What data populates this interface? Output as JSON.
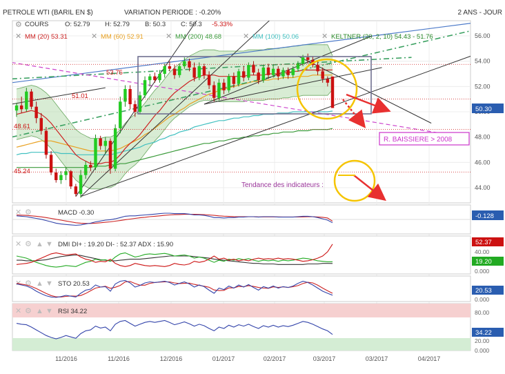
{
  "header": {
    "title": "PETROLE WTI (BARIL EN $)",
    "variation": "VARIATION PERIODE : -0.20%",
    "period": "2 ANS - JOUR"
  },
  "legend": {
    "cours_label": "COURS",
    "open": "O: 52.79",
    "high": "H: 52.79",
    "low": "B: 50.3",
    "close": "C: 50.3",
    "change": "-5.33%",
    "mm20": "MM (20) 53.31",
    "mm60": "MM (60) 52.91",
    "mm200": "MM (200) 48.68",
    "mm100": "MM (100) 50.06",
    "keltner": "KELTNER (20, 2, 10) 54.43 - 51.76"
  },
  "annotations": {
    "levels": [
      "53.75",
      "51.01",
      "48.61",
      "45.24"
    ],
    "resistance_box": "R. BAISSIERE > 2008",
    "tendance": "Tendance des indicateurs :"
  },
  "indicators": {
    "macd": {
      "label": "MACD -0.30",
      "badge": "-0.128"
    },
    "dmi": {
      "label": "DMI DI+ : 19.20 DI- : 52.37 ADX : 15.90",
      "badges": [
        "52.37",
        "19.20"
      ],
      "ticks": [
        "40.00",
        "20.00",
        "0.000"
      ]
    },
    "sto": {
      "label": "STO 20.53",
      "badge": "20.53",
      "ticks": [
        "20.00",
        "0.000"
      ]
    },
    "rsi": {
      "label": "RSI 34.22",
      "badge": "34.22",
      "ticks": [
        "80.00",
        "20.00",
        "0.000"
      ]
    }
  },
  "price_badge": "50.30",
  "colors": {
    "bull": "#22cc22",
    "bear": "#cc1111",
    "mm20": "#cc2222",
    "mm60": "#e8a020",
    "mm200": "#3a9a3a",
    "mm100": "#40c0c0",
    "keltner": "#2a8a2a",
    "annotation_magenta": "#cc33cc",
    "circle": "#f5c400"
  },
  "chart_data": {
    "type": "candlestick",
    "y_ticks": [
      44,
      46,
      48,
      50,
      52,
      54,
      56
    ],
    "y_tick_labels": [
      "44.00",
      "46.00",
      "48.00",
      "50.00",
      "52.00",
      "54.00",
      "56.00"
    ],
    "ylim": [
      42.8,
      57.2
    ],
    "x_tick_labels": [
      "11/2016",
      "11/2016",
      "12/2016",
      "01/2017",
      "02/2017",
      "03/2017",
      "03/2017",
      "04/2017"
    ],
    "candles": [
      {
        "o": 50.1,
        "h": 50.7,
        "l": 49.6,
        "c": 50.5
      },
      {
        "o": 50.5,
        "h": 51.2,
        "l": 49.9,
        "c": 50.2
      },
      {
        "o": 50.2,
        "h": 51.9,
        "l": 50.0,
        "c": 51.6
      },
      {
        "o": 51.6,
        "h": 51.8,
        "l": 50.2,
        "c": 50.4
      },
      {
        "o": 50.4,
        "h": 50.8,
        "l": 49.1,
        "c": 49.5
      },
      {
        "o": 49.5,
        "h": 49.9,
        "l": 48.2,
        "c": 48.5
      },
      {
        "o": 48.5,
        "h": 48.8,
        "l": 46.3,
        "c": 46.6
      },
      {
        "o": 46.6,
        "h": 46.9,
        "l": 45.0,
        "c": 45.2
      },
      {
        "o": 45.2,
        "h": 45.5,
        "l": 44.4,
        "c": 44.6
      },
      {
        "o": 44.6,
        "h": 45.3,
        "l": 44.3,
        "c": 45.0
      },
      {
        "o": 45.0,
        "h": 45.6,
        "l": 44.6,
        "c": 45.3
      },
      {
        "o": 45.3,
        "h": 45.4,
        "l": 43.9,
        "c": 44.1
      },
      {
        "o": 44.1,
        "h": 44.3,
        "l": 43.3,
        "c": 43.5
      },
      {
        "o": 43.5,
        "h": 45.4,
        "l": 43.2,
        "c": 45.0
      },
      {
        "o": 45.0,
        "h": 46.1,
        "l": 44.7,
        "c": 45.8
      },
      {
        "o": 45.8,
        "h": 46.1,
        "l": 45.3,
        "c": 45.6
      },
      {
        "o": 45.6,
        "h": 48.2,
        "l": 45.4,
        "c": 47.9
      },
      {
        "o": 47.9,
        "h": 48.1,
        "l": 47.0,
        "c": 47.3
      },
      {
        "o": 47.3,
        "h": 48.0,
        "l": 46.7,
        "c": 47.7
      },
      {
        "o": 47.7,
        "h": 47.9,
        "l": 45.1,
        "c": 45.5
      },
      {
        "o": 45.5,
        "h": 49.0,
        "l": 45.3,
        "c": 48.7
      },
      {
        "o": 48.7,
        "h": 51.2,
        "l": 48.3,
        "c": 50.8
      },
      {
        "o": 50.8,
        "h": 52.1,
        "l": 50.4,
        "c": 51.8
      },
      {
        "o": 51.8,
        "h": 52.1,
        "l": 50.2,
        "c": 50.6
      },
      {
        "o": 50.6,
        "h": 50.9,
        "l": 49.6,
        "c": 50.0
      },
      {
        "o": 50.0,
        "h": 51.6,
        "l": 49.8,
        "c": 51.3
      },
      {
        "o": 51.3,
        "h": 52.8,
        "l": 51.1,
        "c": 52.5
      },
      {
        "o": 52.5,
        "h": 53.0,
        "l": 52.0,
        "c": 52.8
      },
      {
        "o": 52.8,
        "h": 53.1,
        "l": 52.3,
        "c": 52.5
      },
      {
        "o": 52.5,
        "h": 53.3,
        "l": 52.3,
        "c": 53.0
      },
      {
        "o": 53.0,
        "h": 53.8,
        "l": 52.7,
        "c": 53.6
      },
      {
        "o": 53.6,
        "h": 54.0,
        "l": 53.2,
        "c": 53.4
      },
      {
        "o": 53.4,
        "h": 53.7,
        "l": 52.6,
        "c": 52.9
      },
      {
        "o": 52.9,
        "h": 53.8,
        "l": 52.7,
        "c": 53.6
      },
      {
        "o": 53.6,
        "h": 54.3,
        "l": 53.4,
        "c": 54.0
      },
      {
        "o": 54.0,
        "h": 54.2,
        "l": 53.2,
        "c": 53.5
      },
      {
        "o": 53.5,
        "h": 53.9,
        "l": 52.4,
        "c": 52.7
      },
      {
        "o": 52.7,
        "h": 53.9,
        "l": 52.5,
        "c": 53.6
      },
      {
        "o": 53.6,
        "h": 53.8,
        "l": 52.6,
        "c": 52.9
      },
      {
        "o": 52.9,
        "h": 53.2,
        "l": 51.8,
        "c": 52.1
      },
      {
        "o": 52.1,
        "h": 52.4,
        "l": 50.8,
        "c": 51.1
      },
      {
        "o": 51.1,
        "h": 52.6,
        "l": 50.9,
        "c": 52.3
      },
      {
        "o": 52.3,
        "h": 52.6,
        "l": 51.4,
        "c": 51.7
      },
      {
        "o": 51.7,
        "h": 53.0,
        "l": 51.5,
        "c": 52.8
      },
      {
        "o": 52.8,
        "h": 53.1,
        "l": 51.9,
        "c": 52.2
      },
      {
        "o": 52.2,
        "h": 53.4,
        "l": 52.0,
        "c": 53.2
      },
      {
        "o": 53.2,
        "h": 53.6,
        "l": 52.4,
        "c": 52.7
      },
      {
        "o": 52.7,
        "h": 53.9,
        "l": 52.5,
        "c": 53.7
      },
      {
        "o": 53.7,
        "h": 54.0,
        "l": 52.9,
        "c": 53.1
      },
      {
        "o": 53.1,
        "h": 53.4,
        "l": 52.2,
        "c": 52.5
      },
      {
        "o": 52.5,
        "h": 53.7,
        "l": 52.3,
        "c": 53.5
      },
      {
        "o": 53.5,
        "h": 53.8,
        "l": 52.6,
        "c": 52.9
      },
      {
        "o": 52.9,
        "h": 53.7,
        "l": 52.7,
        "c": 53.4
      },
      {
        "o": 53.4,
        "h": 53.6,
        "l": 52.5,
        "c": 52.8
      },
      {
        "o": 52.8,
        "h": 53.5,
        "l": 52.6,
        "c": 53.3
      },
      {
        "o": 53.3,
        "h": 53.5,
        "l": 52.6,
        "c": 52.9
      },
      {
        "o": 52.9,
        "h": 53.6,
        "l": 52.7,
        "c": 53.4
      },
      {
        "o": 53.4,
        "h": 54.0,
        "l": 53.2,
        "c": 53.8
      },
      {
        "o": 53.8,
        "h": 54.5,
        "l": 53.6,
        "c": 54.3
      },
      {
        "o": 54.3,
        "h": 54.6,
        "l": 53.8,
        "c": 54.1
      },
      {
        "o": 54.1,
        "h": 54.4,
        "l": 53.5,
        "c": 53.7
      },
      {
        "o": 53.7,
        "h": 54.0,
        "l": 52.9,
        "c": 53.2
      },
      {
        "o": 53.2,
        "h": 53.5,
        "l": 52.3,
        "c": 52.6
      },
      {
        "o": 52.6,
        "h": 52.8,
        "l": 52.0,
        "c": 52.3
      },
      {
        "o": 52.79,
        "h": 52.79,
        "l": 50.3,
        "c": 50.3
      }
    ],
    "mm20": [
      49.8,
      49.9,
      50.0,
      50.1,
      50.0,
      49.8,
      49.5,
      49.1,
      48.6,
      48.1,
      47.6,
      47.1,
      46.6,
      46.3,
      46.1,
      45.9,
      45.9,
      45.9,
      46.0,
      46.0,
      46.2,
      46.6,
      47.1,
      47.5,
      47.8,
      48.2,
      48.7,
      49.2,
      49.7,
      50.1,
      50.6,
      51.1,
      51.5,
      51.8,
      52.1,
      52.4,
      52.6,
      52.8,
      52.9,
      52.9,
      52.9,
      52.8,
      52.8,
      52.8,
      52.8,
      52.8,
      52.8,
      52.9,
      52.9,
      52.9,
      52.9,
      53.0,
      53.0,
      53.0,
      53.1,
      53.1,
      53.2,
      53.2,
      53.3,
      53.3,
      53.3,
      53.3,
      53.3,
      53.3,
      53.31
    ],
    "mm60": [
      47.2,
      47.3,
      47.4,
      47.5,
      47.6,
      47.7,
      47.7,
      47.7,
      47.6,
      47.5,
      47.4,
      47.3,
      47.2,
      47.1,
      47.0,
      46.9,
      46.9,
      46.9,
      46.9,
      46.9,
      47.0,
      47.1,
      47.3,
      47.5,
      47.7,
      47.9,
      48.2,
      48.4,
      48.7,
      49.0,
      49.3,
      49.6,
      49.8,
      50.1,
      50.3,
      50.6,
      50.8,
      51.0,
      51.2,
      51.4,
      51.5,
      51.7,
      51.8,
      51.9,
      52.0,
      52.1,
      52.2,
      52.3,
      52.4,
      52.4,
      52.5,
      52.5,
      52.6,
      52.6,
      52.7,
      52.7,
      52.7,
      52.8,
      52.8,
      52.8,
      52.9,
      52.9,
      52.9,
      52.9,
      52.91
    ],
    "mm100": [
      46.6,
      46.7,
      46.7,
      46.8,
      46.8,
      46.8,
      46.8,
      46.8,
      46.8,
      46.7,
      46.7,
      46.7,
      46.6,
      46.6,
      46.6,
      46.6,
      46.6,
      46.6,
      46.6,
      46.6,
      46.7,
      46.8,
      46.9,
      47.0,
      47.1,
      47.2,
      47.4,
      47.5,
      47.6,
      47.8,
      47.9,
      48.1,
      48.2,
      48.4,
      48.5,
      48.6,
      48.8,
      48.9,
      49.0,
      49.1,
      49.2,
      49.3,
      49.3,
      49.4,
      49.5,
      49.5,
      49.6,
      49.6,
      49.7,
      49.7,
      49.8,
      49.8,
      49.8,
      49.9,
      49.9,
      49.9,
      50.0,
      50.0,
      50.0,
      50.0,
      50.0,
      50.0,
      50.0,
      50.0,
      50.06
    ],
    "mm200": [
      45.6,
      45.6,
      45.6,
      45.6,
      45.6,
      45.6,
      45.6,
      45.6,
      45.6,
      45.6,
      45.6,
      45.6,
      45.6,
      45.6,
      45.6,
      45.6,
      45.7,
      45.7,
      45.7,
      45.8,
      45.8,
      45.9,
      45.9,
      46.0,
      46.1,
      46.2,
      46.3,
      46.4,
      46.5,
      46.6,
      46.7,
      46.8,
      46.9,
      47.0,
      47.1,
      47.2,
      47.3,
      47.4,
      47.5,
      47.5,
      47.6,
      47.7,
      47.7,
      47.8,
      47.9,
      47.9,
      48.0,
      48.0,
      48.1,
      48.1,
      48.2,
      48.2,
      48.3,
      48.3,
      48.4,
      48.4,
      48.4,
      48.5,
      48.5,
      48.5,
      48.6,
      48.6,
      48.6,
      48.6,
      48.68
    ],
    "keltner_upper": [
      51.8,
      51.9,
      52.0,
      52.1,
      52.0,
      51.8,
      51.5,
      51.1,
      50.6,
      50.1,
      49.6,
      49.1,
      48.6,
      48.3,
      48.1,
      47.9,
      47.9,
      47.9,
      48.0,
      48.0,
      48.2,
      48.6,
      49.1,
      49.5,
      49.8,
      50.2,
      50.7,
      51.2,
      51.7,
      52.1,
      52.6,
      53.1,
      53.5,
      53.8,
      54.1,
      54.4,
      54.6,
      54.8,
      54.9,
      54.9,
      54.9,
      54.8,
      54.8,
      54.8,
      54.8,
      54.8,
      54.8,
      54.9,
      54.9,
      54.9,
      54.9,
      55.0,
      55.0,
      55.0,
      55.1,
      55.1,
      55.2,
      55.2,
      55.3,
      55.3,
      55.3,
      55.3,
      55.3,
      55.3,
      54.43
    ],
    "keltner_lower": [
      47.8,
      47.9,
      48.0,
      48.1,
      48.0,
      47.8,
      47.5,
      47.1,
      46.6,
      46.1,
      45.6,
      45.1,
      44.6,
      44.3,
      44.1,
      43.9,
      43.9,
      43.9,
      44.0,
      44.0,
      44.2,
      44.6,
      45.1,
      45.5,
      45.8,
      46.2,
      46.7,
      47.2,
      47.7,
      48.1,
      48.6,
      49.1,
      49.5,
      49.8,
      50.1,
      50.4,
      50.6,
      50.8,
      50.9,
      50.9,
      50.9,
      50.8,
      50.8,
      50.8,
      50.8,
      50.8,
      50.8,
      50.9,
      50.9,
      50.9,
      50.9,
      51.0,
      51.0,
      51.0,
      51.1,
      51.1,
      51.2,
      51.2,
      51.3,
      51.3,
      51.3,
      51.3,
      51.3,
      51.3,
      51.76
    ],
    "macd_line": [
      0.5,
      0.45,
      0.4,
      0.3,
      0.2,
      0.1,
      -0.05,
      -0.2,
      -0.35,
      -0.45,
      -0.5,
      -0.55,
      -0.6,
      -0.55,
      -0.45,
      -0.35,
      -0.2,
      -0.1,
      0.0,
      0.05,
      0.15,
      0.3,
      0.45,
      0.5,
      0.5,
      0.55,
      0.6,
      0.65,
      0.7,
      0.75,
      0.8,
      0.8,
      0.75,
      0.75,
      0.75,
      0.7,
      0.6,
      0.6,
      0.55,
      0.45,
      0.3,
      0.3,
      0.25,
      0.3,
      0.3,
      0.35,
      0.35,
      0.4,
      0.4,
      0.35,
      0.4,
      0.4,
      0.4,
      0.35,
      0.35,
      0.35,
      0.35,
      0.4,
      0.45,
      0.45,
      0.4,
      0.3,
      0.15,
      0.0,
      -0.3
    ],
    "macd_signal": [
      0.6,
      0.58,
      0.55,
      0.5,
      0.45,
      0.38,
      0.3,
      0.2,
      0.1,
      0.0,
      -0.1,
      -0.2,
      -0.3,
      -0.35,
      -0.38,
      -0.38,
      -0.35,
      -0.3,
      -0.25,
      -0.2,
      -0.12,
      -0.05,
      0.05,
      0.12,
      0.2,
      0.27,
      0.33,
      0.4,
      0.45,
      0.5,
      0.55,
      0.6,
      0.63,
      0.65,
      0.67,
      0.68,
      0.67,
      0.66,
      0.64,
      0.6,
      0.55,
      0.5,
      0.46,
      0.43,
      0.41,
      0.4,
      0.39,
      0.39,
      0.39,
      0.38,
      0.38,
      0.38,
      0.38,
      0.38,
      0.37,
      0.37,
      0.37,
      0.37,
      0.38,
      0.39,
      0.39,
      0.37,
      0.33,
      0.25,
      -0.128
    ],
    "dmi_plus": [
      30,
      28,
      26,
      22,
      18,
      15,
      12,
      10,
      9,
      10,
      12,
      11,
      10,
      14,
      18,
      20,
      24,
      22,
      23,
      20,
      28,
      34,
      36,
      32,
      28,
      30,
      33,
      34,
      33,
      34,
      35,
      33,
      30,
      31,
      32,
      30,
      26,
      28,
      26,
      22,
      18,
      22,
      20,
      24,
      22,
      25,
      23,
      25,
      22,
      20,
      22,
      21,
      22,
      20,
      22,
      21,
      22,
      24,
      26,
      25,
      23,
      21,
      20,
      19,
      19.2
    ],
    "dmi_minus": [
      14,
      15,
      16,
      18,
      22,
      26,
      30,
      34,
      36,
      34,
      32,
      33,
      34,
      28,
      24,
      22,
      18,
      20,
      19,
      24,
      16,
      12,
      10,
      12,
      16,
      14,
      12,
      11,
      12,
      11,
      10,
      12,
      16,
      14,
      13,
      15,
      20,
      18,
      20,
      24,
      30,
      24,
      26,
      22,
      24,
      21,
      23,
      21,
      24,
      26,
      24,
      25,
      24,
      26,
      24,
      25,
      24,
      22,
      20,
      21,
      23,
      26,
      30,
      38,
      52.37
    ],
    "dmi_adx": [
      22,
      22,
      21,
      21,
      21,
      22,
      23,
      25,
      27,
      29,
      30,
      31,
      32,
      31,
      29,
      27,
      25,
      23,
      22,
      21,
      21,
      22,
      23,
      24,
      24,
      24,
      25,
      26,
      27,
      28,
      29,
      30,
      30,
      30,
      30,
      30,
      29,
      28,
      27,
      26,
      24,
      23,
      22,
      21,
      20,
      19,
      18,
      17,
      16,
      16,
      15,
      15,
      15,
      14,
      14,
      14,
      14,
      14,
      14,
      15,
      15,
      15,
      16,
      16,
      15.9
    ],
    "sto_k": [
      75,
      70,
      65,
      55,
      40,
      28,
      18,
      12,
      10,
      14,
      20,
      16,
      12,
      30,
      45,
      50,
      70,
      60,
      62,
      40,
      75,
      88,
      92,
      80,
      60,
      68,
      80,
      85,
      82,
      85,
      88,
      82,
      70,
      78,
      85,
      75,
      60,
      70,
      62,
      45,
      30,
      55,
      48,
      65,
      55,
      70,
      60,
      72,
      58,
      45,
      62,
      55,
      65,
      55,
      62,
      58,
      65,
      78,
      88,
      82,
      70,
      55,
      40,
      30,
      20.53
    ],
    "sto_d": [
      78,
      74,
      70,
      63,
      53,
      41,
      29,
      19,
      13,
      12,
      15,
      17,
      16,
      19,
      29,
      42,
      55,
      60,
      64,
      54,
      59,
      68,
      85,
      87,
      77,
      69,
      69,
      78,
      82,
      84,
      85,
      85,
      80,
      77,
      78,
      79,
      73,
      68,
      64,
      59,
      46,
      43,
      44,
      56,
      56,
      63,
      62,
      67,
      63,
      58,
      55,
      54,
      61,
      58,
      61,
      58,
      62,
      67,
      77,
      83,
      80,
      69,
      55,
      42,
      30
    ]
  },
  "rsi_data": [
    58,
    56,
    55,
    50,
    44,
    38,
    32,
    28,
    25,
    28,
    32,
    29,
    26,
    36,
    42,
    44,
    52,
    48,
    50,
    42,
    56,
    62,
    64,
    58,
    52,
    56,
    60,
    62,
    60,
    62,
    64,
    60,
    55,
    58,
    61,
    57,
    52,
    56,
    53,
    47,
    42,
    50,
    47,
    54,
    50,
    55,
    52,
    56,
    51,
    47,
    53,
    50,
    54,
    50,
    53,
    51,
    54,
    58,
    62,
    60,
    56,
    51,
    46,
    42,
    34.22
  ]
}
